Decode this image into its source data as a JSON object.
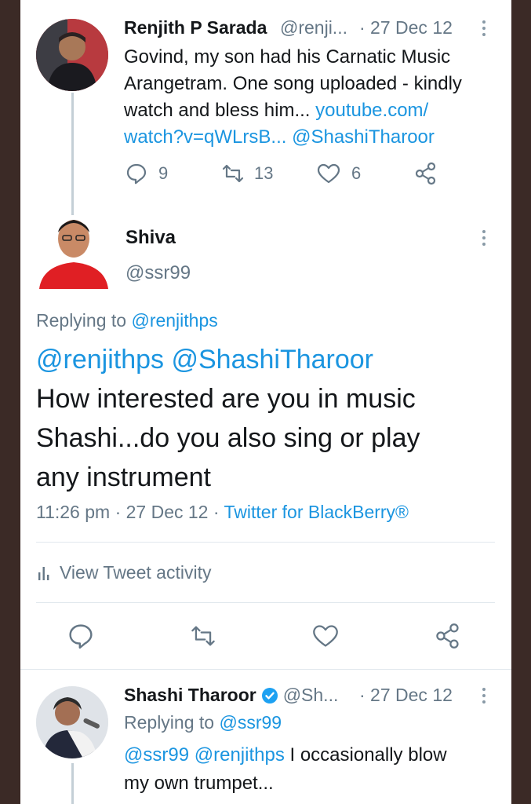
{
  "tweet1": {
    "name": "Renjith P Sarada",
    "handle": "@renji...",
    "date": "· 27 Dec 12",
    "text_l1": "Govind, my son had his Carnatic Music",
    "text_l2": "Arangetram.  One song uploaded - kindly",
    "text_l3": "watch and bless him...",
    "link_l3": "youtube.com/",
    "link_l4": "watch?v=qWLrsB...",
    "mention_l4": "@ShashiTharoor",
    "replies": "9",
    "retweets": "13",
    "likes": "6"
  },
  "tweet2": {
    "name": "Shiva",
    "handle": "@ssr99",
    "replying_prefix": "Replying to",
    "replying_to": "@renjithps",
    "mention1": "@renjithps",
    "mention2": "@ShashiTharoor",
    "body_l1": "How interested are you in music",
    "body_l2": "Shashi...do you also sing or play",
    "body_l3": "any instrument",
    "time_date": "11:26 pm · 27 Dec 12 ·",
    "source": "Twitter for BlackBerry®",
    "activity_label": "View Tweet activity"
  },
  "tweet3": {
    "name": "Shashi Tharoor",
    "handle": "@Sh...",
    "date": "· 27 Dec 12",
    "replying_prefix": "Replying to",
    "replying_to": "@ssr99",
    "mention1": "@ssr99",
    "mention2": "@renjithps",
    "text_l1_rest": " I occasionally blow",
    "text_l2": "my own trumpet..."
  },
  "colors": {
    "link": "#1b95e0",
    "muted": "#657786",
    "verified": "#1da1f2",
    "frame": "#3b2a26"
  },
  "icons": [
    "reply-icon",
    "retweet-icon",
    "like-icon",
    "share-icon",
    "more-icon",
    "activity-icon",
    "verified-icon"
  ]
}
